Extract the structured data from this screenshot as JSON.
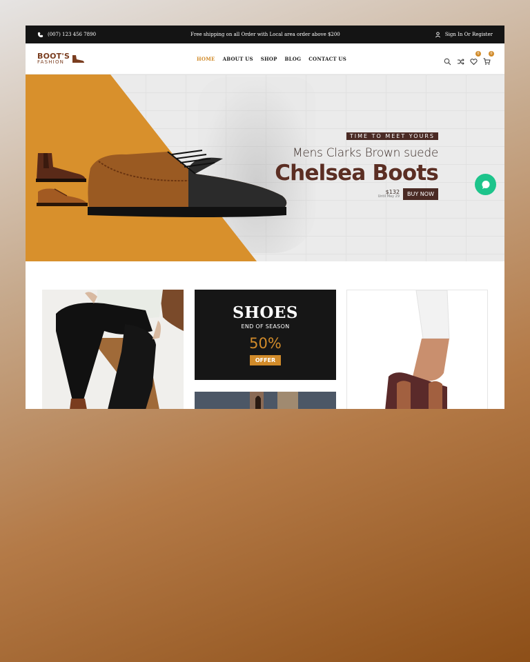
{
  "topbar": {
    "phone": "(007) 123 456 7890",
    "shipping": "Free shipping on all Order with Local area order above $200",
    "signin": "Sign In Or Register"
  },
  "header": {
    "logo_main": "BOOT'S",
    "logo_sub": "FASHION",
    "nav": [
      "HOME",
      "ABOUT US",
      "SHOP",
      "BLOG",
      "CONTACT US"
    ],
    "active_nav": "HOME",
    "wishlist_count": "0",
    "cart_count": "0"
  },
  "hero": {
    "tag": "TIME TO MEET YOURS",
    "subtitle": "Mens Clarks Brown suede",
    "title": "Chelsea Boots",
    "price": "$132",
    "until": "Until May 29",
    "button": "BUY NOW"
  },
  "promo": {
    "title": "SHOES",
    "subtitle": "END OF SEASON",
    "discount": "50%",
    "button": "OFFER"
  },
  "colors": {
    "accent": "#d18b2a",
    "brown": "#5b2e23",
    "dark": "#141414",
    "chat": "#1dc48b"
  }
}
